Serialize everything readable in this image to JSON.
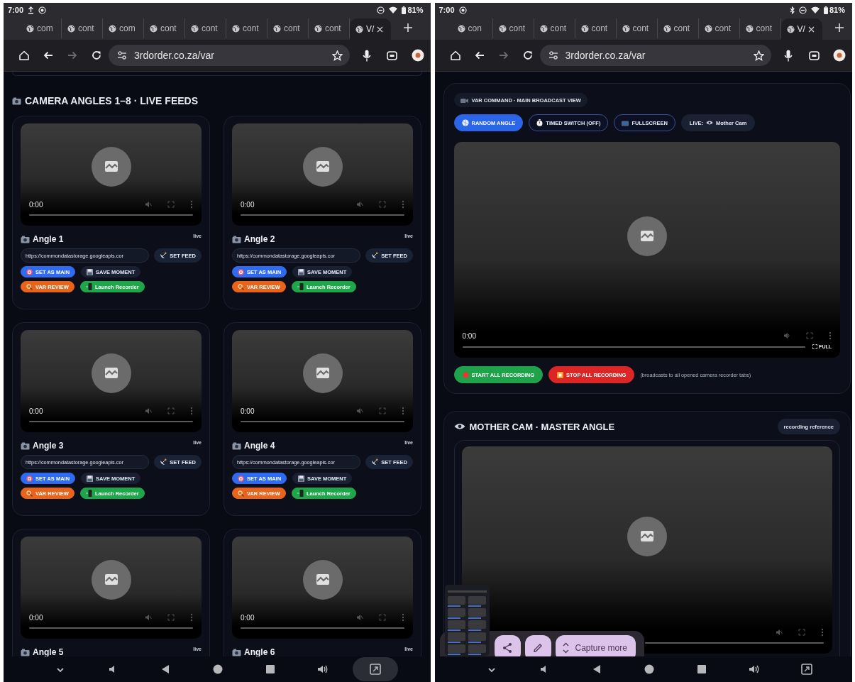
{
  "screens": [
    {
      "status_bar": {
        "time": "7:00",
        "upload_notification": true,
        "bluetooth": false,
        "battery": "81%"
      },
      "tabs": [
        {
          "label": "com",
          "selected": false
        },
        {
          "label": "cont",
          "selected": false
        },
        {
          "label": "com",
          "selected": false
        },
        {
          "label": "cont",
          "selected": false
        },
        {
          "label": "cont",
          "selected": false
        },
        {
          "label": "cont",
          "selected": false
        },
        {
          "label": "cont",
          "selected": false
        },
        {
          "label": "cont",
          "selected": false
        },
        {
          "label": "V/",
          "selected": true
        }
      ],
      "toolbar": {
        "url": "3rdorder.co.za/var",
        "forward_disabled": true
      },
      "content": {
        "kind": "angles",
        "heading": "CAMERA ANGLES 1–8 · LIVE FEEDS",
        "cards": [
          {
            "title": "Angle 1",
            "badge": "live",
            "time": "0:00",
            "url": "https://commondatastorage.googleapis.cor",
            "buttons": [
              {
                "label": "SET FEED",
                "kind": "feed"
              },
              {
                "label": "SET AS MAIN",
                "kind": "main"
              },
              {
                "label": "SAVE MOMENT",
                "kind": "save"
              },
              {
                "label": "VAR REVIEW",
                "kind": "review"
              },
              {
                "label": "Launch Recorder",
                "kind": "recorder"
              }
            ]
          },
          {
            "title": "Angle 2",
            "badge": "live",
            "time": "0:00",
            "url": "https://commondatastorage.googleapis.cor",
            "buttons": [
              {
                "label": "SET FEED",
                "kind": "feed"
              },
              {
                "label": "SET AS MAIN",
                "kind": "main"
              },
              {
                "label": "SAVE MOMENT",
                "kind": "save"
              },
              {
                "label": "VAR REVIEW",
                "kind": "review"
              },
              {
                "label": "Launch Recorder",
                "kind": "recorder"
              }
            ]
          },
          {
            "title": "Angle 3",
            "badge": "live",
            "time": "0:00",
            "url": "https://commondatastorage.googleapis.cor",
            "buttons": [
              {
                "label": "SET FEED",
                "kind": "feed"
              },
              {
                "label": "SET AS MAIN",
                "kind": "main"
              },
              {
                "label": "SAVE MOMENT",
                "kind": "save"
              },
              {
                "label": "VAR REVIEW",
                "kind": "review"
              },
              {
                "label": "Launch Recorder",
                "kind": "recorder"
              }
            ]
          },
          {
            "title": "Angle 4",
            "badge": "live",
            "time": "0:00",
            "url": "https://commondatastorage.googleapis.cor",
            "buttons": [
              {
                "label": "SET FEED",
                "kind": "feed"
              },
              {
                "label": "SET AS MAIN",
                "kind": "main"
              },
              {
                "label": "SAVE MOMENT",
                "kind": "save"
              },
              {
                "label": "VAR REVIEW",
                "kind": "review"
              },
              {
                "label": "Launch Recorder",
                "kind": "recorder"
              }
            ]
          },
          {
            "title": "Angle 5",
            "badge": "live",
            "time": "0:00"
          },
          {
            "title": "Angle 6",
            "badge": "live",
            "time": "0:00"
          }
        ]
      },
      "nav_pressed": true
    },
    {
      "status_bar": {
        "time": "7:00",
        "upload_notification": false,
        "bluetooth": true,
        "battery": "81%"
      },
      "tabs": [
        {
          "label": "con",
          "selected": false
        },
        {
          "label": "cont",
          "selected": false
        },
        {
          "label": "cont",
          "selected": false
        },
        {
          "label": "cont",
          "selected": false
        },
        {
          "label": "cont",
          "selected": false
        },
        {
          "label": "cont",
          "selected": false
        },
        {
          "label": "cont",
          "selected": false
        },
        {
          "label": "cont",
          "selected": false
        },
        {
          "label": "V/",
          "selected": true
        }
      ],
      "toolbar": {
        "url": "3rdorder.co.za/var",
        "forward_disabled": true
      },
      "content": {
        "kind": "command",
        "header": "VAR COMMAND · MAIN BROADCAST VIEW",
        "controls": [
          {
            "label": "RANDOM ANGLE",
            "kind": "random"
          },
          {
            "label": "TIMED SWITCH (OFF)",
            "kind": "timer"
          },
          {
            "label": "FULLSCREEN",
            "kind": "fullscreen"
          }
        ],
        "live": {
          "label": "LIVE:",
          "source": "Mother Cam"
        },
        "main_video": {
          "time": "0:00",
          "full_label": "FULL"
        },
        "recording": [
          {
            "label": "START ALL RECORDING",
            "kind": "start"
          },
          {
            "label": "STOP ALL RECORDING",
            "kind": "stop"
          }
        ],
        "note": "(broadcasts to all opened camera recorder tabs)",
        "master": {
          "title": "MOTHER CAM · MASTER ANGLE",
          "badge": "recording reference"
        },
        "capture": {
          "label": "Capture more"
        }
      },
      "nav_pressed": false
    }
  ]
}
